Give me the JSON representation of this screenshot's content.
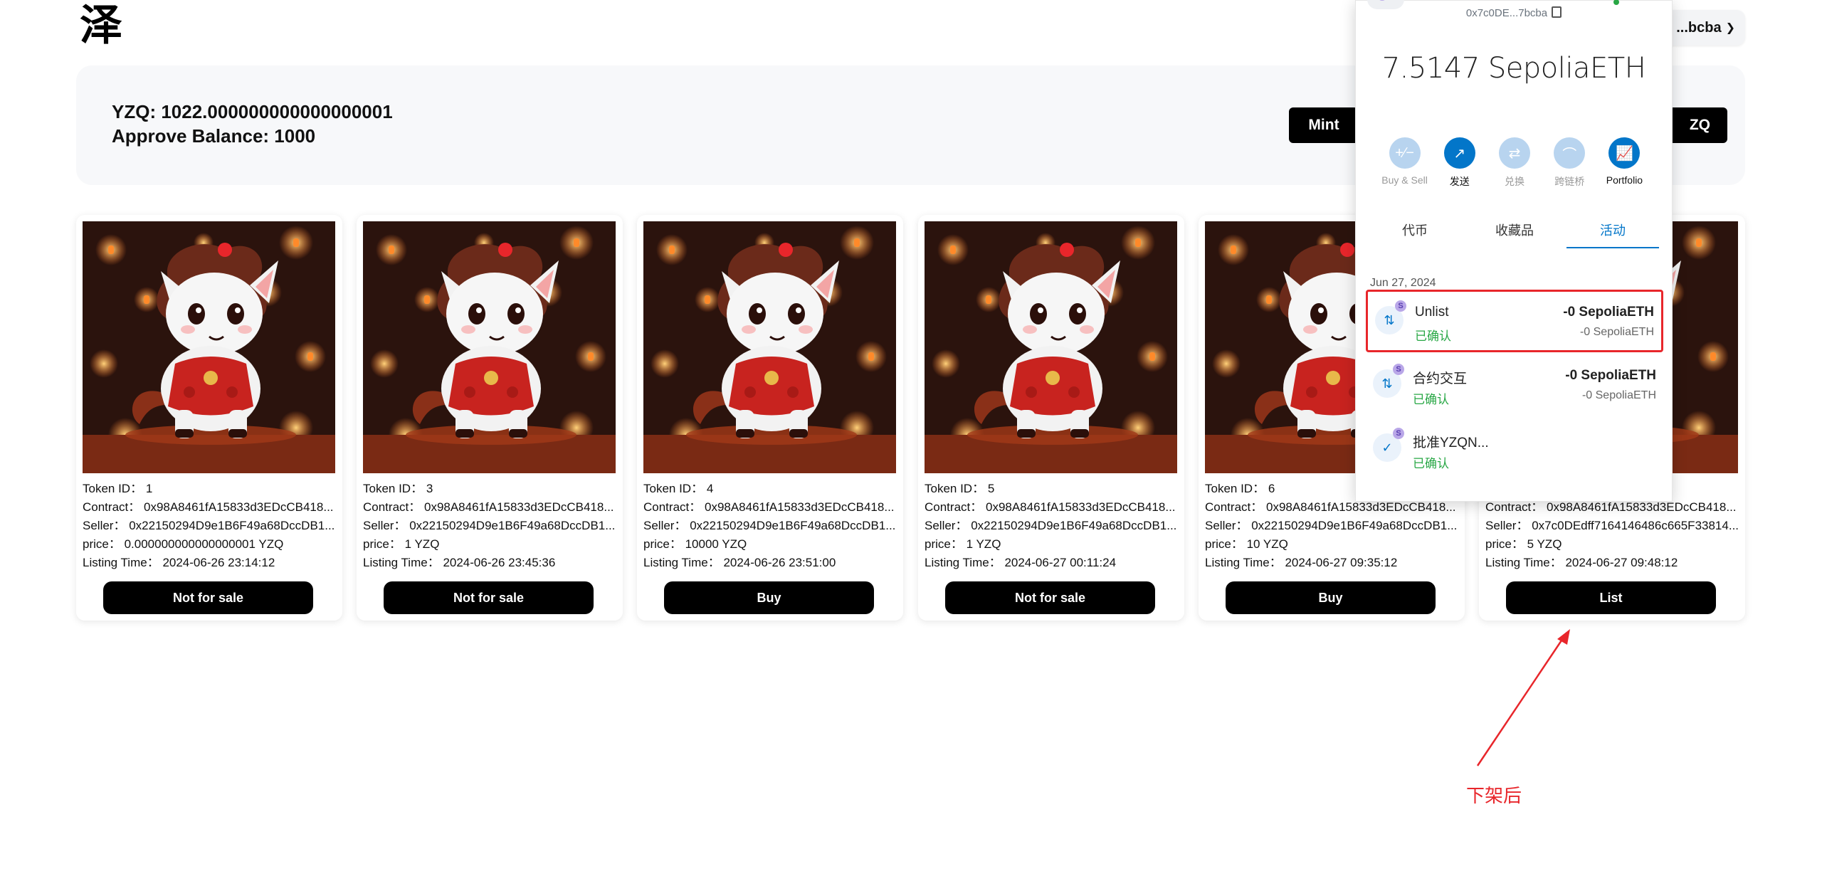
{
  "logo": {
    "text": "泽"
  },
  "account": {
    "short": "...bcba"
  },
  "balance": {
    "yzq": "YZQ: 1022.000000000000000001",
    "approve": "Approve Balance: 1000",
    "mint_label": "Mint",
    "yzq_button_label": "ZQ"
  },
  "labels": {
    "token_id": "Token ID：",
    "contract": "Contract：",
    "seller": "Seller：",
    "price": "price：",
    "listing_time": "Listing Time："
  },
  "cards": [
    {
      "token_id": "1",
      "contract": "0x98A8461fA15833d3EDcCB418...",
      "seller": "0x22150294D9e1B6F49a68DccDB1...",
      "price": "0.000000000000000001 YZQ",
      "listing_time": "2024-06-26 23:14:12",
      "button": "Not for sale"
    },
    {
      "token_id": "3",
      "contract": "0x98A8461fA15833d3EDcCB418...",
      "seller": "0x22150294D9e1B6F49a68DccDB1...",
      "price": "1 YZQ",
      "listing_time": "2024-06-26 23:45:36",
      "button": "Not for sale"
    },
    {
      "token_id": "4",
      "contract": "0x98A8461fA15833d3EDcCB418...",
      "seller": "0x22150294D9e1B6F49a68DccDB1...",
      "price": "10000 YZQ",
      "listing_time": "2024-06-26 23:51:00",
      "button": "Buy"
    },
    {
      "token_id": "5",
      "contract": "0x98A8461fA15833d3EDcCB418...",
      "seller": "0x22150294D9e1B6F49a68DccDB1...",
      "price": "1 YZQ",
      "listing_time": "2024-06-27 00:11:24",
      "button": "Not for sale"
    },
    {
      "token_id": "6",
      "contract": "0x98A8461fA15833d3EDcCB418...",
      "seller": "0x22150294D9e1B6F49a68DccDB1...",
      "price": "10 YZQ",
      "listing_time": "2024-06-27 09:35:12",
      "button": "Buy"
    },
    {
      "token_id": "",
      "contract": "0x98A8461fA15833d3EDcCB418...",
      "seller": "0x7c0DEdff7164146486c665F33814...",
      "price": "5 YZQ",
      "listing_time": "2024-06-27 09:48:12",
      "button": "List"
    }
  ],
  "wallet": {
    "address": "0x7c0DE...7bcba",
    "balance": "7.5147 SepoliaETH",
    "actions": [
      {
        "label": "Buy & Sell",
        "icon": "plus-minus-icon",
        "glyph": "+∕−",
        "active": false
      },
      {
        "label": "发送",
        "icon": "send-arrow-icon",
        "glyph": "↗",
        "active": true
      },
      {
        "label": "兑换",
        "icon": "swap-icon",
        "glyph": "⇄",
        "active": false
      },
      {
        "label": "跨链桥",
        "icon": "bridge-icon",
        "glyph": "⌒",
        "active": false
      },
      {
        "label": "Portfolio",
        "icon": "chart-icon",
        "glyph": "📈",
        "active": true
      }
    ],
    "tabs": [
      {
        "label": "代币",
        "active": false
      },
      {
        "label": "收藏品",
        "active": false
      },
      {
        "label": "活动",
        "active": true
      }
    ],
    "date": "Jun 27, 2024",
    "transactions": [
      {
        "title": "Unlist",
        "status": "已确认",
        "amount": "-0 SepoliaETH",
        "amount2": "-0 SepoliaETH",
        "icon": "contract-interaction-icon",
        "highlight": true
      },
      {
        "title": "合约交互",
        "status": "已确认",
        "amount": "-0 SepoliaETH",
        "amount2": "-0 SepoliaETH",
        "icon": "contract-interaction-icon",
        "highlight": false
      },
      {
        "title": "批准YZQN...",
        "status": "已确认",
        "amount": "",
        "amount2": "",
        "icon": "check-icon",
        "highlight": false
      }
    ]
  },
  "annotation": {
    "text": "下架后",
    "color": "#e8262b"
  }
}
